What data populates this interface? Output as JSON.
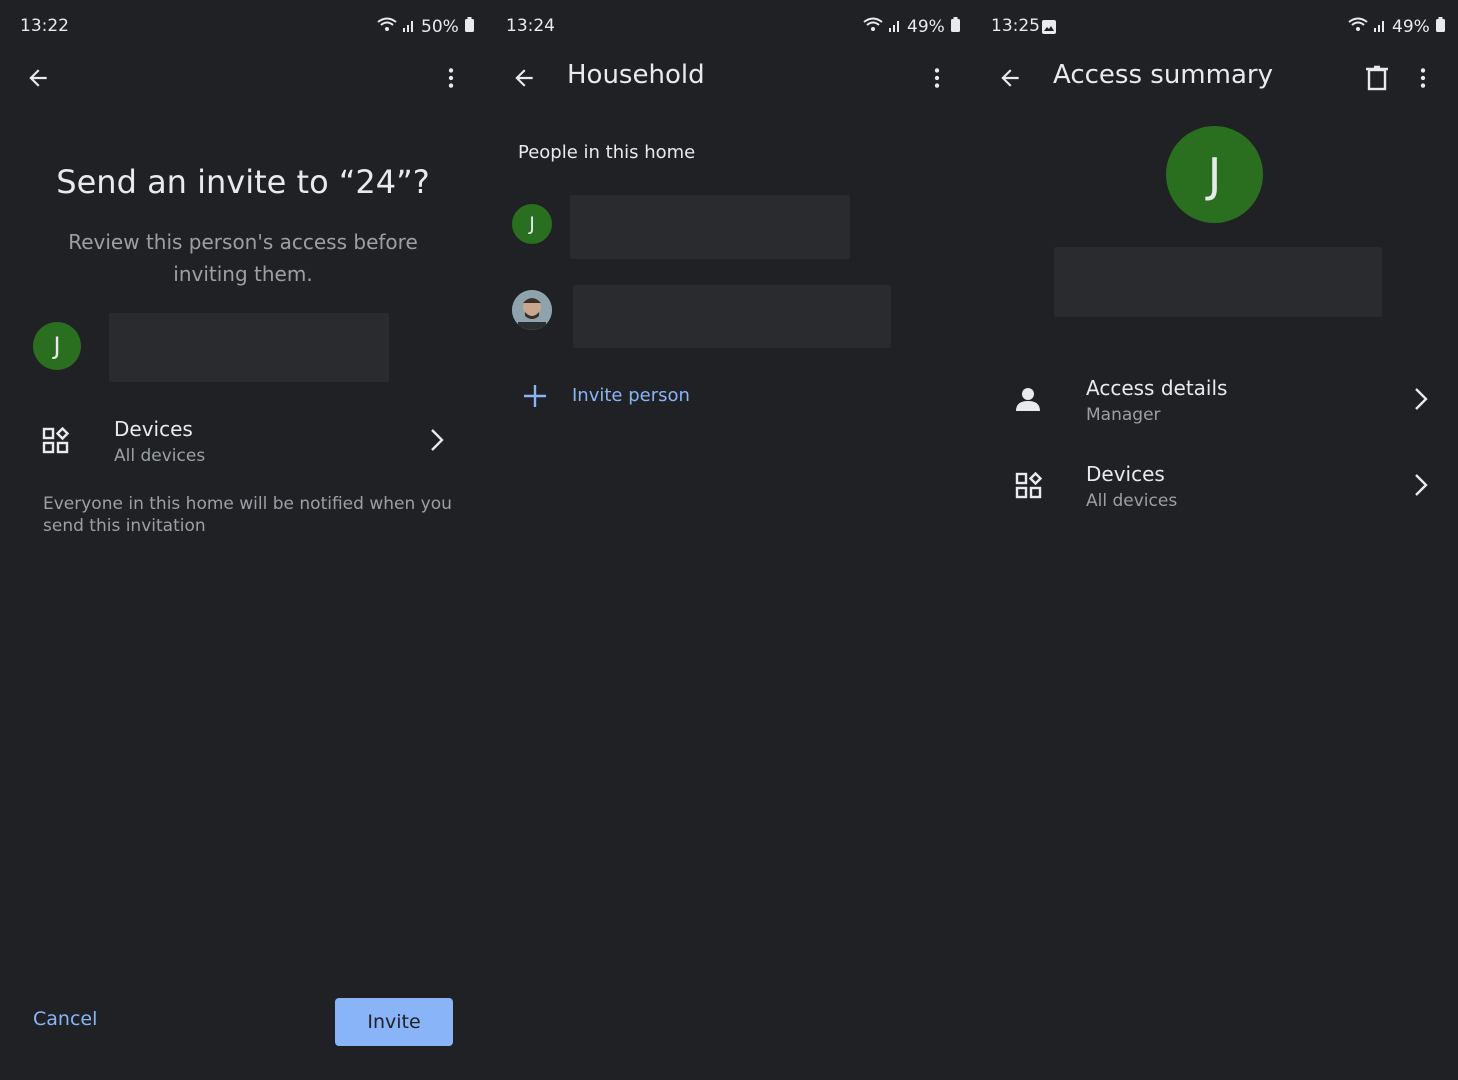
{
  "colors": {
    "background": "#202124",
    "accent": "#8ab4f8",
    "avatar_green": "#2a6e1f",
    "text_primary": "#e8eaed",
    "text_secondary": "#9aa0a6"
  },
  "screen1": {
    "status": {
      "time": "13:22",
      "battery": "50%"
    },
    "title": "Send an invite to “24”?",
    "subtitle": "Review this person's access before inviting them.",
    "avatar_initial": "J",
    "devices": {
      "label": "Devices",
      "value": "All devices"
    },
    "notice": "Everyone in this home will be notified when you send this invitation",
    "cancel_label": "Cancel",
    "invite_label": "Invite",
    "icons": {
      "back": "arrow-left-icon",
      "menu": "more-vert-icon",
      "devices": "devices-icon",
      "chevron": "chevron-right-icon"
    }
  },
  "screen2": {
    "status": {
      "time": "13:24",
      "battery": "49%"
    },
    "title": "Household",
    "section_label": "People in this home",
    "people": [
      {
        "avatar_initial": "J"
      },
      {
        "avatar_initial": ""
      }
    ],
    "invite_label": "Invite person",
    "icons": {
      "back": "arrow-left-icon",
      "menu": "more-vert-icon",
      "add": "plus-icon"
    }
  },
  "screen3": {
    "status": {
      "time": "13:25",
      "battery": "49%"
    },
    "title": "Access summary",
    "avatar_initial": "J",
    "rows": [
      {
        "label": "Access details",
        "value": "Manager",
        "icon": "person-icon"
      },
      {
        "label": "Devices",
        "value": "All devices",
        "icon": "devices-icon"
      }
    ],
    "icons": {
      "back": "arrow-left-icon",
      "delete": "trash-icon",
      "menu": "more-vert-icon",
      "chevron": "chevron-right-icon"
    }
  }
}
